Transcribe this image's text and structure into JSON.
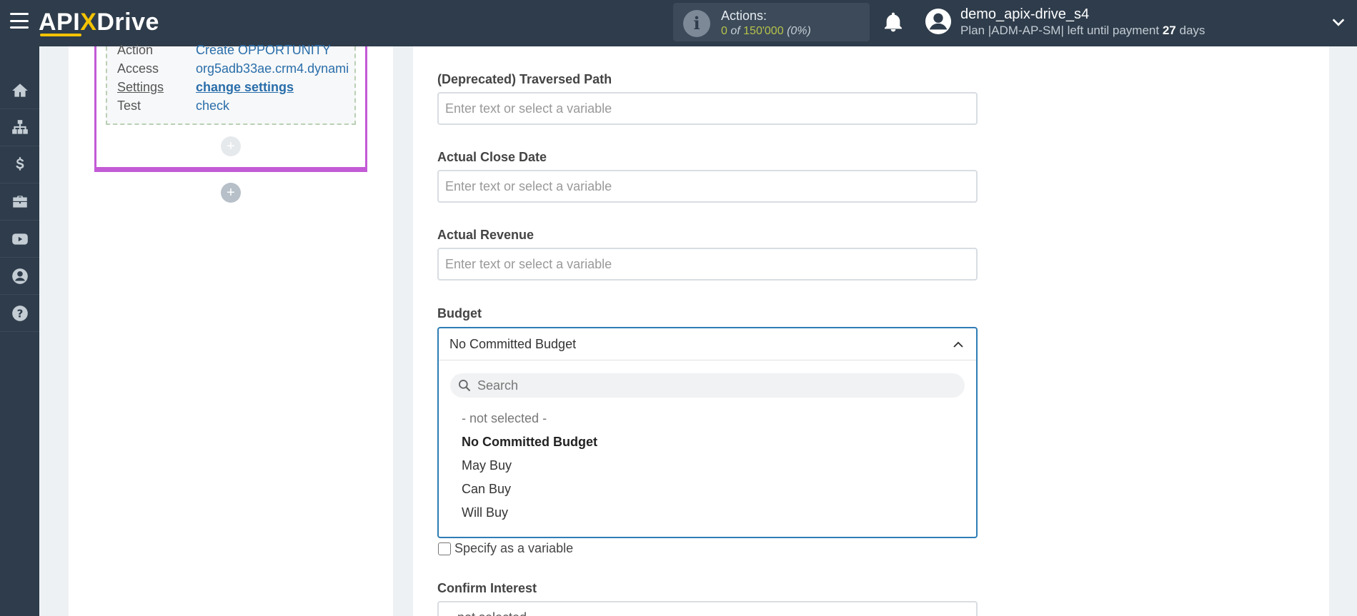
{
  "header": {
    "logo_left": "API",
    "logo_x": "X",
    "logo_right": "Drive",
    "actions_title": "Actions:",
    "actions_used": "0",
    "actions_of": "of",
    "actions_total": "150'000",
    "actions_percent": "(0%)",
    "username": "demo_apix-drive_s4",
    "plan_text": "Plan |ADM-AP-SM| left until payment",
    "plan_days": "27",
    "plan_days_unit": "days"
  },
  "sidebar": {
    "icons": [
      "home-icon",
      "sitemap-icon",
      "dollar-icon",
      "briefcase-icon",
      "youtube-icon",
      "user-circle-icon",
      "help-icon"
    ]
  },
  "block": {
    "rows": [
      {
        "label": "Action",
        "value": "Create OPPORTUNITY"
      },
      {
        "label": "Access",
        "value": "org5adb33ae.crm4.dynami"
      },
      {
        "label": "Settings",
        "value": "change settings"
      },
      {
        "label": "Test",
        "value": "check"
      }
    ],
    "plus": "+"
  },
  "form": {
    "traversed_path": {
      "label": "(Deprecated) Traversed Path",
      "placeholder": "Enter text or select a variable"
    },
    "actual_close_date": {
      "label": "Actual Close Date",
      "placeholder": "Enter text or select a variable"
    },
    "actual_revenue": {
      "label": "Actual Revenue",
      "placeholder": "Enter text or select a variable"
    },
    "budget": {
      "label": "Budget",
      "value": "No Committed Budget",
      "search_placeholder": "Search",
      "options": [
        "- not selected -",
        "No Committed Budget",
        "May Buy",
        "Can Buy",
        "Will Buy"
      ]
    },
    "specify_variable": "Specify as a variable",
    "confirm_interest": {
      "label": "Confirm Interest",
      "value": "- not selected -"
    }
  },
  "colors": {
    "topbar": "#2e3c4b",
    "accent_purple": "#c35bd6",
    "link_blue": "#2a6eaa",
    "focus_blue": "#2e7db5",
    "logo_yellow": "#f5c400"
  }
}
